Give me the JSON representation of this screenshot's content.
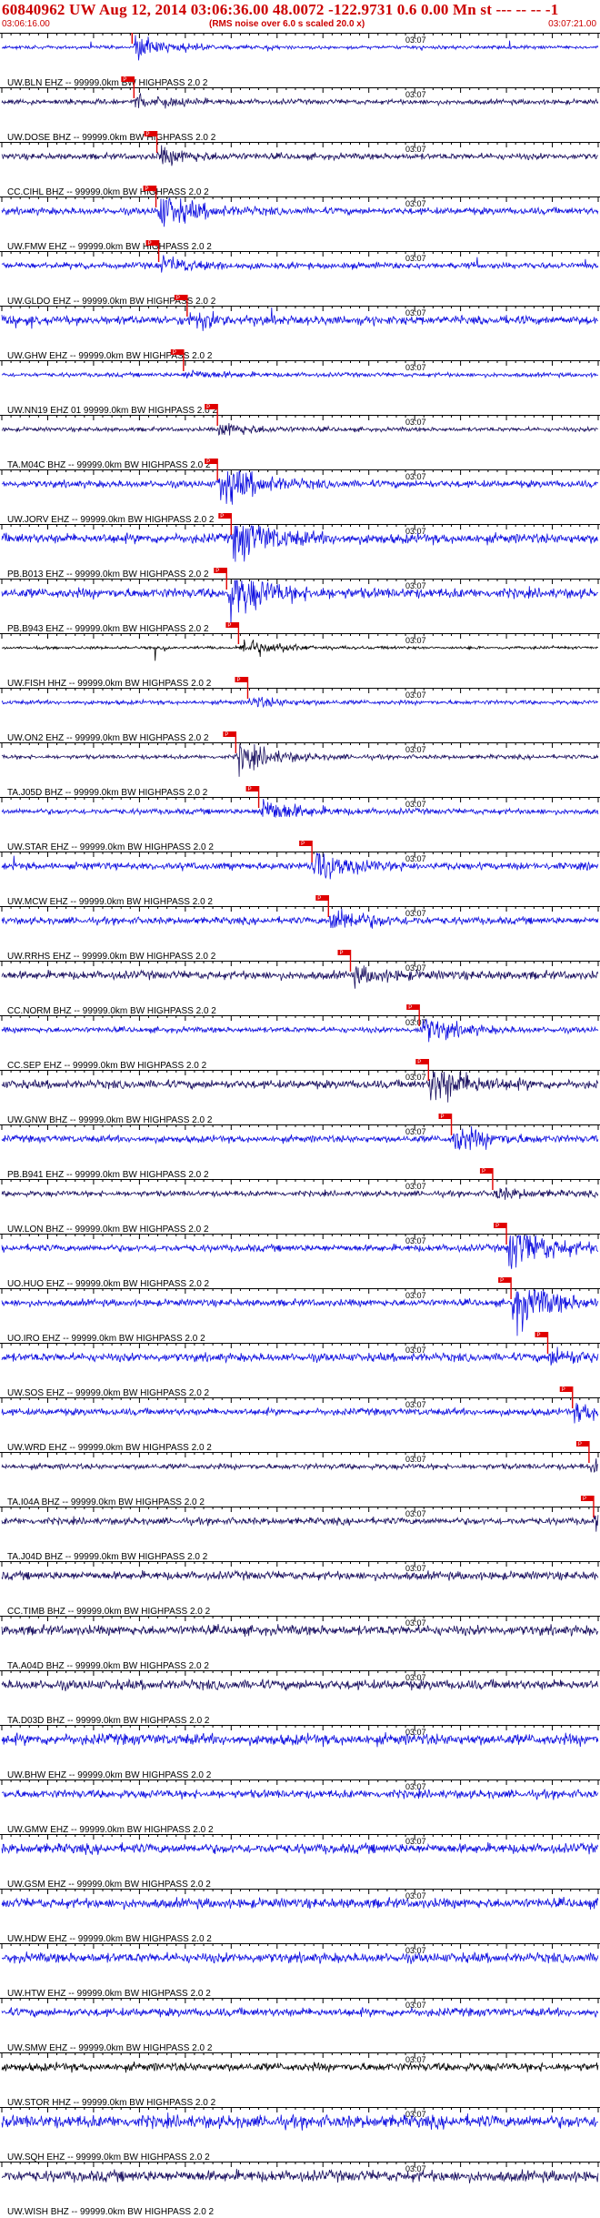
{
  "header": {
    "title": "60840962 UW Aug 12, 2014 03:06:36.00   48.0072  -122.9731  0.6 0.00 Mn st --- -- --   -1",
    "start_time": "03:06:16.00",
    "noise_note": "(RMS noise over 6.0 s scaled 20.0 x)",
    "end_time": "03:07:21.00"
  },
  "chart_data": {
    "type": "seismogram",
    "x_range_s": [
      0,
      65
    ],
    "tick_label": "03:07",
    "pick_label": "P",
    "grid": false,
    "colors": {
      "blue": "#1010e0",
      "dark": "#1a1060",
      "black": "#000000",
      "pick": "#e00000"
    },
    "traces": [
      {
        "label": "UW.BLN  EHZ -- 99999.0km BW  HIGHPASS  2.0  2",
        "color": "blue",
        "pick_s": 14.2,
        "amp": 0.12,
        "event_amp": 0.85,
        "spikes": true
      },
      {
        "label": "UW.DOSE BHZ -- 99999.0km BW  HIGHPASS  2.0  2",
        "color": "dark",
        "pick_s": 14.4,
        "amp": 0.18,
        "event_amp": 0.45
      },
      {
        "label": "CC.CIHL BHZ -- 99999.0km BW  HIGHPASS  2.0  2",
        "color": "dark",
        "pick_s": 16.9,
        "amp": 0.22,
        "event_amp": 0.55
      },
      {
        "label": "UW.FMW  EHZ -- 99999.0km BW  HIGHPASS  2.0  2",
        "color": "blue",
        "pick_s": 16.8,
        "amp": 0.25,
        "event_amp": 1.3
      },
      {
        "label": "UW.GLDO EHZ -- 99999.0km BW  HIGHPASS  2.0  2",
        "color": "blue",
        "pick_s": 17.1,
        "amp": 0.22,
        "event_amp": 0.5,
        "spikes": true
      },
      {
        "label": "UW.GHW  EHZ -- 99999.0km BW  HIGHPASS  2.0  2",
        "color": "blue",
        "pick_s": 20.2,
        "amp": 0.3,
        "event_amp": 0.6,
        "spikes": true
      },
      {
        "label": "UW.NN19 EHZ 01 99999.0km BW  HIGHPASS  2.0  2",
        "color": "blue",
        "pick_s": 19.8,
        "amp": 0.15,
        "event_amp": 0.3
      },
      {
        "label": "TA.M04C BHZ -- 99999.0km BW  HIGHPASS  2.0  2",
        "color": "dark",
        "pick_s": 23.5,
        "amp": 0.15,
        "event_amp": 0.5
      },
      {
        "label": "UW.JORV EHZ -- 99999.0km BW  HIGHPASS  2.0  2",
        "color": "blue",
        "pick_s": 23.5,
        "amp": 0.25,
        "event_amp": 1.6
      },
      {
        "label": "PB.B013 EHZ -- 99999.0km BW  HIGHPASS  2.0  2",
        "color": "blue",
        "pick_s": 25.0,
        "amp": 0.35,
        "event_amp": 1.7
      },
      {
        "label": "PB.B943 EHZ -- 99999.0km BW  HIGHPASS  2.0  2",
        "color": "blue",
        "pick_s": 24.5,
        "amp": 0.35,
        "event_amp": 1.8
      },
      {
        "label": "UW.FISH HHZ -- 99999.0km BW  HIGHPASS  2.0  2",
        "color": "black",
        "pick_s": 25.8,
        "amp": 0.1,
        "event_amp": 0.7,
        "spikes": true
      },
      {
        "label": "UW.ON2  EHZ -- 99999.0km BW  HIGHPASS  2.0  2",
        "color": "blue",
        "pick_s": 26.8,
        "amp": 0.15,
        "event_amp": 0.35
      },
      {
        "label": "TA.J05D BHZ -- 99999.0km BW  HIGHPASS  2.0  2",
        "color": "dark",
        "pick_s": 25.5,
        "amp": 0.15,
        "event_amp": 1.1
      },
      {
        "label": "UW.STAR EHZ -- 99999.0km BW  HIGHPASS  2.0  2",
        "color": "blue",
        "pick_s": 28.0,
        "amp": 0.2,
        "event_amp": 0.9
      },
      {
        "label": "UW.MCW  EHZ -- 99999.0km BW  HIGHPASS  2.0  2",
        "color": "blue",
        "pick_s": 33.8,
        "amp": 0.25,
        "event_amp": 1.0,
        "spikes": true
      },
      {
        "label": "UW.RRHS EHZ -- 99999.0km BW  HIGHPASS  2.0  2",
        "color": "blue",
        "pick_s": 35.6,
        "amp": 0.25,
        "event_amp": 0.9
      },
      {
        "label": "CC.NORM BHZ -- 99999.0km BW  HIGHPASS  2.0  2",
        "color": "dark",
        "pick_s": 38.0,
        "amp": 0.3,
        "event_amp": 0.5
      },
      {
        "label": "CC.SEP  EHZ -- 99999.0km BW  HIGHPASS  2.0  2",
        "color": "blue",
        "pick_s": 45.5,
        "amp": 0.2,
        "event_amp": 0.9
      },
      {
        "label": "UW.GNW  BHZ -- 99999.0km BW  HIGHPASS  2.0  2",
        "color": "dark",
        "pick_s": 46.5,
        "amp": 0.3,
        "event_amp": 1.6
      },
      {
        "label": "PB.B941 EHZ -- 99999.0km BW  HIGHPASS  2.0  2",
        "color": "blue",
        "pick_s": 49.0,
        "amp": 0.25,
        "event_amp": 0.9
      },
      {
        "label": "UW.LON  BHZ -- 99999.0km BW  HIGHPASS  2.0  2",
        "color": "dark",
        "pick_s": 53.5,
        "amp": 0.2,
        "event_amp": 0.35
      },
      {
        "label": "UO.HUO  EHZ -- 99999.0km BW  HIGHPASS  2.0  2",
        "color": "blue",
        "pick_s": 55.0,
        "amp": 0.25,
        "event_amp": 2.0
      },
      {
        "label": "UO.IRO  EHZ -- 99999.0km BW  HIGHPASS  2.0  2",
        "color": "blue",
        "pick_s": 55.5,
        "amp": 0.25,
        "event_amp": 1.9
      },
      {
        "label": "UW.SOS  EHZ -- 99999.0km BW  HIGHPASS  2.0  2",
        "color": "blue",
        "pick_s": 59.5,
        "amp": 0.3,
        "event_amp": 0.5
      },
      {
        "label": "UW.WRD  EHZ -- 99999.0km BW  HIGHPASS  2.0  2",
        "color": "blue",
        "pick_s": 62.2,
        "amp": 0.25,
        "event_amp": 0.6
      },
      {
        "label": "TA.I04A BHZ -- 99999.0km BW  HIGHPASS  2.0  2",
        "color": "dark",
        "pick_s": 64.0,
        "amp": 0.2,
        "event_amp": 0.4
      },
      {
        "label": "TA.J04D BHZ -- 99999.0km BW  HIGHPASS  2.0  2",
        "color": "dark",
        "pick_s": 64.5,
        "amp": 0.25,
        "event_amp": 0.8
      },
      {
        "label": "CC.TIMB BHZ -- 99999.0km BW  HIGHPASS  2.0  2",
        "color": "dark",
        "amp": 0.3
      },
      {
        "label": "TA.A04D BHZ -- 99999.0km BW  HIGHPASS  2.0  2",
        "color": "dark",
        "amp": 0.35
      },
      {
        "label": "TA.D03D BHZ -- 99999.0km BW  HIGHPASS  2.0  2",
        "color": "dark",
        "amp": 0.35
      },
      {
        "label": "UW.BHW  EHZ -- 99999.0km BW  HIGHPASS  2.0  2",
        "color": "blue",
        "amp": 0.4
      },
      {
        "label": "UW.GMW  EHZ -- 99999.0km BW  HIGHPASS  2.0  2",
        "color": "blue",
        "amp": 0.3
      },
      {
        "label": "UW.GSM  EHZ -- 99999.0km BW  HIGHPASS  2.0  2",
        "color": "blue",
        "amp": 0.35
      },
      {
        "label": "UW.HDW  EHZ -- 99999.0km BW  HIGHPASS  2.0  2",
        "color": "blue",
        "amp": 0.35
      },
      {
        "label": "UW.HTW  EHZ -- 99999.0km BW  HIGHPASS  2.0  2",
        "color": "blue",
        "amp": 0.35
      },
      {
        "label": "UW.SMW  EHZ -- 99999.0km BW  HIGHPASS  2.0  2",
        "color": "blue",
        "amp": 0.3
      },
      {
        "label": "UW.STOR HHZ -- 99999.0km BW  HIGHPASS  2.0  2",
        "color": "black",
        "amp": 0.3
      },
      {
        "label": "UW.SQH  EHZ -- 99999.0km BW  HIGHPASS  2.0  2",
        "color": "blue",
        "amp": 0.45
      },
      {
        "label": "UW.WISH BHZ -- 99999.0km BW  HIGHPASS  2.0  2",
        "color": "dark",
        "amp": 0.4
      }
    ]
  }
}
